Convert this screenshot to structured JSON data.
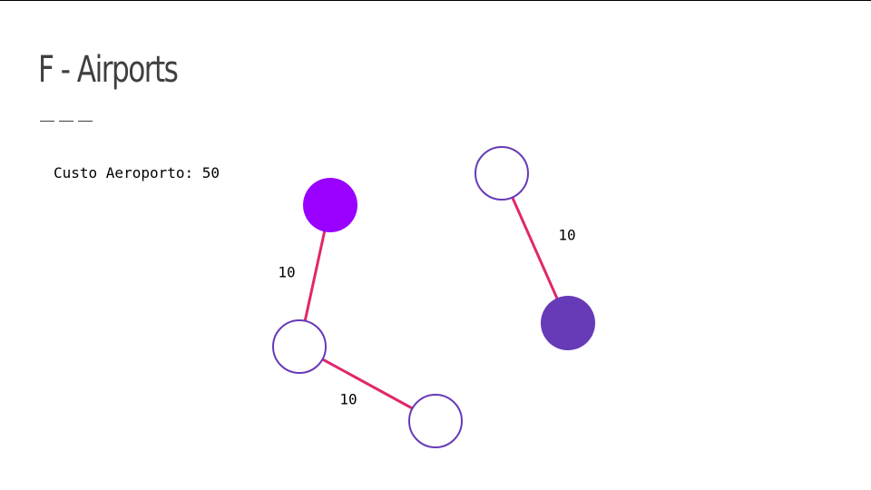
{
  "slide": {
    "title": "F - Airports",
    "cost_label": "Custo Aeroporto: 50"
  },
  "colors": {
    "edge": "#e0286a",
    "node_stroke": "#673ab7",
    "airport_bright": "#9900ff",
    "airport_deep": "#673ab7",
    "empty_fill": "#ffffff"
  },
  "graph": {
    "nodes": [
      {
        "id": "n1",
        "type": "airport-bright"
      },
      {
        "id": "n2",
        "type": "empty"
      },
      {
        "id": "n3",
        "type": "empty"
      },
      {
        "id": "n4",
        "type": "empty"
      },
      {
        "id": "n5",
        "type": "airport-deep"
      }
    ],
    "edges": [
      {
        "from": "n1",
        "to": "n2",
        "weight": "10"
      },
      {
        "from": "n2",
        "to": "n3",
        "weight": "10"
      },
      {
        "from": "n4",
        "to": "n5",
        "weight": "10"
      }
    ]
  }
}
